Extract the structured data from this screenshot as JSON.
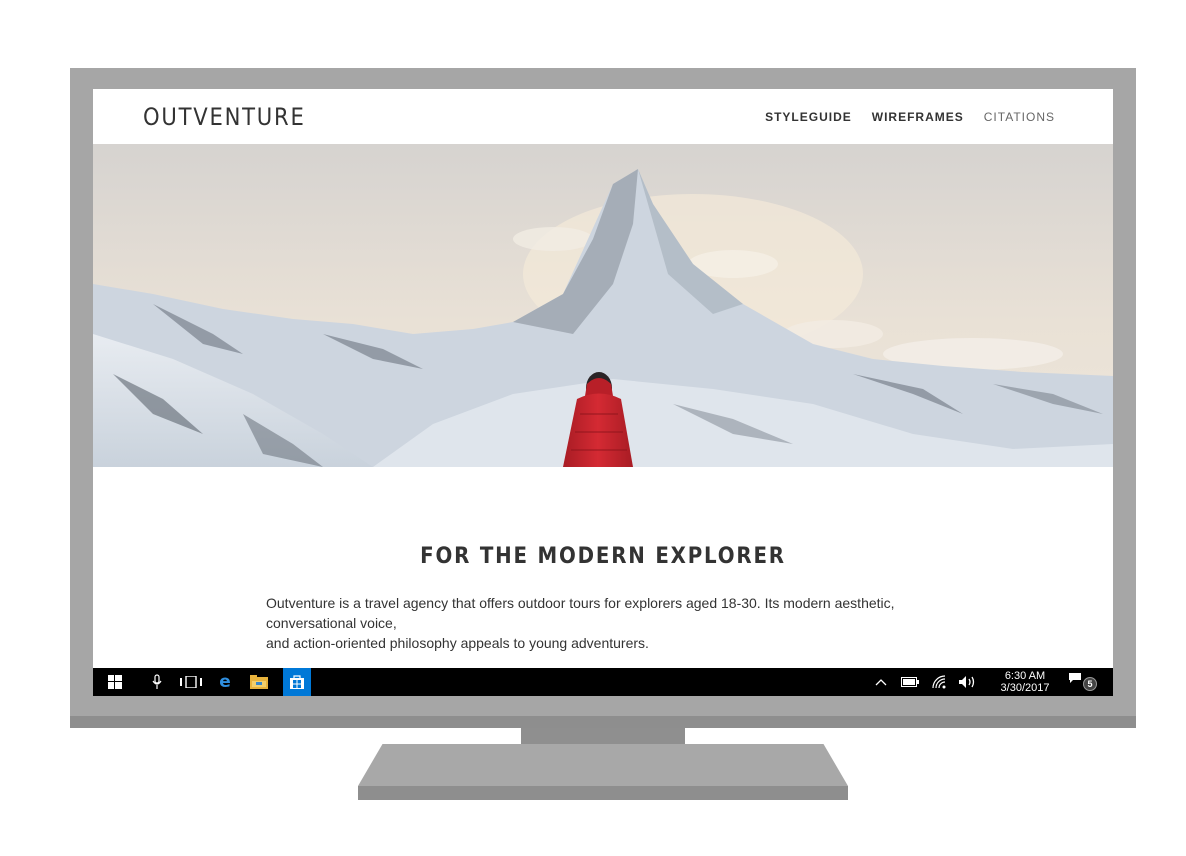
{
  "site": {
    "logo": "OUTVENTURE",
    "nav": [
      {
        "label": "STYLEGUIDE"
      },
      {
        "label": "WIREFRAMES"
      },
      {
        "label": "CITATIONS"
      }
    ]
  },
  "hero": {
    "image": "snowy mountain peak with hiker in red jacket"
  },
  "main": {
    "headline": "FOR THE MODERN EXPLORER",
    "paragraph_line1": "Outventure is a travel agency that offers outdoor tours for explorers aged 18-30. Its modern aesthetic, conversational voice,",
    "paragraph_line2": "and action-oriented philosophy appeals to young adventurers."
  },
  "taskbar": {
    "icons": [
      "windows-start-icon",
      "microphone-icon",
      "task-view-icon",
      "edge-browser-icon",
      "file-explorer-icon",
      "store-icon"
    ],
    "tray_icons": [
      "chevron-up-icon",
      "battery-icon",
      "wifi-icon",
      "volume-icon"
    ],
    "time": "6:30 AM",
    "date": "3/30/2017",
    "notification_count": "5"
  },
  "colors": {
    "bezel": "#a6a6a6",
    "taskbar": "#000000",
    "store_highlight": "#0078d7",
    "jacket": "#c8232b"
  }
}
